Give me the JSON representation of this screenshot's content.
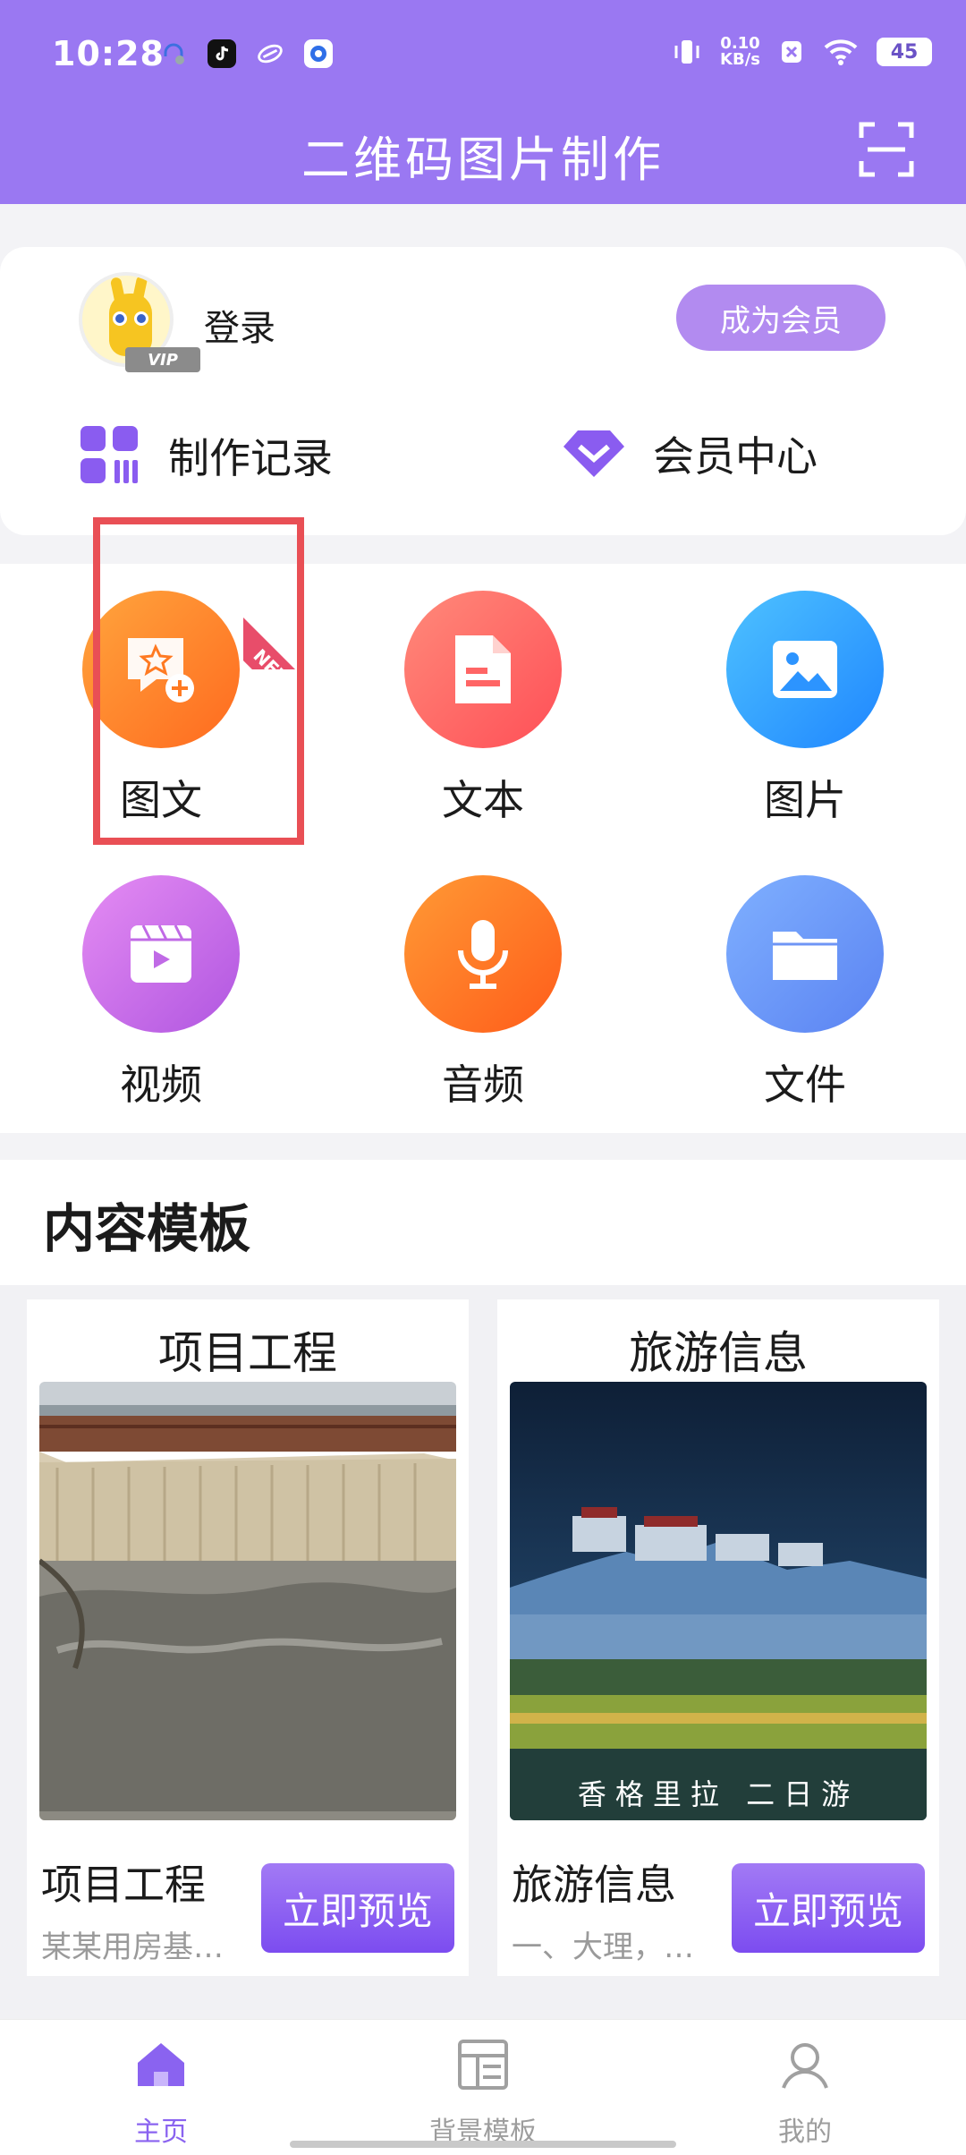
{
  "status_bar": {
    "time": "10:28",
    "net_speed_value": "0.10",
    "net_speed_unit": "KB/s",
    "battery": "45"
  },
  "header": {
    "title": "二维码图片制作"
  },
  "user": {
    "login_label": "登录",
    "vip_tag": "VIP",
    "member_button": "成为会员",
    "record_link": "制作记录",
    "member_center_link": "会员中心"
  },
  "features": {
    "items": [
      {
        "label": "图文",
        "icon": "image-text-icon"
      },
      {
        "label": "文本",
        "icon": "document-icon"
      },
      {
        "label": "图片",
        "icon": "picture-icon"
      },
      {
        "label": "视频",
        "icon": "video-icon"
      },
      {
        "label": "音频",
        "icon": "microphone-icon"
      },
      {
        "label": "文件",
        "icon": "folder-icon"
      }
    ],
    "new_badge": "NEW"
  },
  "templates": {
    "heading": "内容模板",
    "cards": [
      {
        "title": "项目工程",
        "name": "项目工程",
        "desc": "某某用房基…",
        "button": "立即预览"
      },
      {
        "title": "旅游信息",
        "name": "旅游信息",
        "desc": "一、大理，…",
        "button": "立即预览",
        "photo_caption": "香格里拉 二日游"
      }
    ]
  },
  "bottom_nav": {
    "home": "主页",
    "backgrounds": "背景模板",
    "mine": "我的"
  },
  "colors": {
    "brand": "#9a78f2",
    "highlight": "#e94f55"
  }
}
